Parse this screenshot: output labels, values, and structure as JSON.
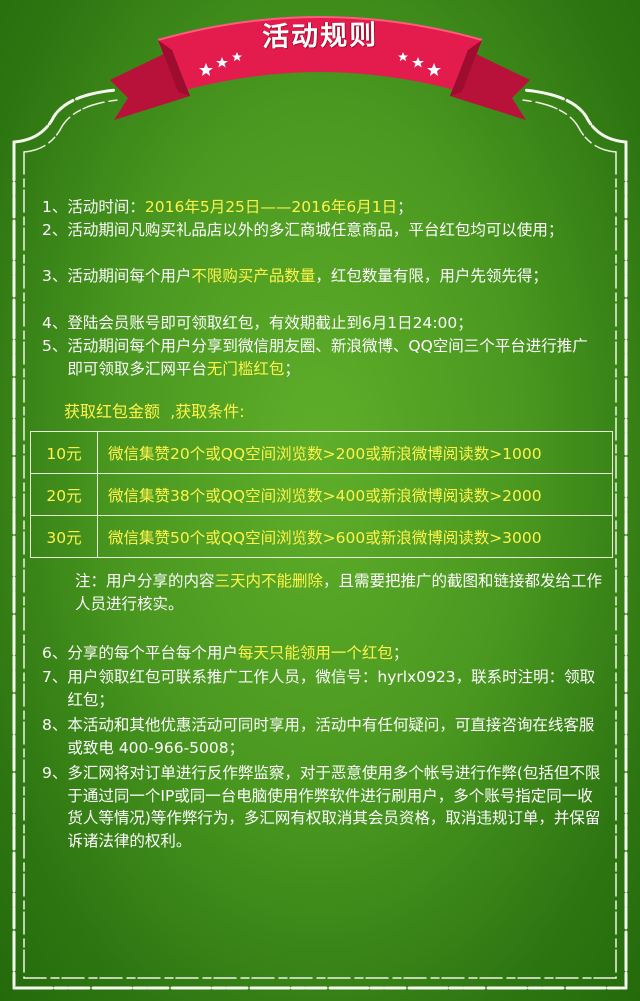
{
  "banner": {
    "title": "活动规则"
  },
  "rules_a": [
    {
      "num": "1、",
      "parts": [
        {
          "t": "活动时间："
        },
        {
          "t": "2016年5月25日——2016年6月1日",
          "hl": true
        },
        {
          "t": "；"
        }
      ]
    },
    {
      "num": "2、",
      "parts": [
        {
          "t": "活动期间凡购买礼品店以外的多汇商城任意商品，平台红包均可以使用；"
        }
      ]
    },
    {
      "num": "3、",
      "parts": [
        {
          "t": "活动期间每个用户"
        },
        {
          "t": "不限购买产品数量",
          "hl": true
        },
        {
          "t": "，红包数量有限，用户先领先得；"
        }
      ]
    },
    {
      "num": "4、",
      "parts": [
        {
          "t": "登陆会员账号即可领取红包，有效期截止到6月1日24:00；"
        }
      ]
    },
    {
      "num": "5、",
      "parts": [
        {
          "t": "活动期间每个用户分享到微信朋友圈、新浪微博、QQ空间三个平台进行推广即可领取多汇网平台"
        },
        {
          "t": "无门槛红包",
          "hl": true
        },
        {
          "t": "；"
        }
      ]
    }
  ],
  "rewards": {
    "heading": "获取红包金额  ,获取条件:",
    "rows": [
      {
        "amount": "10元",
        "condition": "微信集赞20个或QQ空间浏览数>200或新浪微博阅读数>1000"
      },
      {
        "amount": "20元",
        "condition": "微信集赞38个或QQ空间浏览数>400或新浪微博阅读数>2000"
      },
      {
        "amount": "30元",
        "condition": "微信集赞50个或QQ空间浏览数>600或新浪微博阅读数>3000"
      }
    ]
  },
  "note": {
    "parts": [
      {
        "t": "注：用户分享的内容"
      },
      {
        "t": "三天内不能删除",
        "hl": true
      },
      {
        "t": "，且需要把推广的截图和链接都发给工作人员进行核实。"
      }
    ]
  },
  "rules_b": [
    {
      "num": "6、",
      "parts": [
        {
          "t": "分享的每个平台每个用户"
        },
        {
          "t": "每天只能领用一个红包",
          "hl": true
        },
        {
          "t": "；"
        }
      ]
    },
    {
      "num": "7、",
      "parts": [
        {
          "t": "用户领取红包可联系推广工作人员，微信号：hyrlx0923，联系时注明：领取红包；"
        }
      ]
    },
    {
      "num": "8、",
      "parts": [
        {
          "t": "本活动和其他优惠活动可同时享用，活动中有任何疑问，可直接咨询在线客服或致电 400-966-5008；"
        }
      ]
    },
    {
      "num": "9、",
      "parts": [
        {
          "t": "多汇网将对订单进行反作弊监察，对于恶意使用多个帐号进行作弊(包括但不限于通过同一个IP或同一台电脑使用作弊软件进行刷用户，多个账号指定同一收货人等情况)等作弊行为，多汇网有权取消其会员资格，取消违规订单，并保留诉诸法律的权利。"
        }
      ]
    }
  ],
  "colors": {
    "highlight": "#fff44a",
    "ribbon": "#e01a4a",
    "background": "#4a9820"
  }
}
